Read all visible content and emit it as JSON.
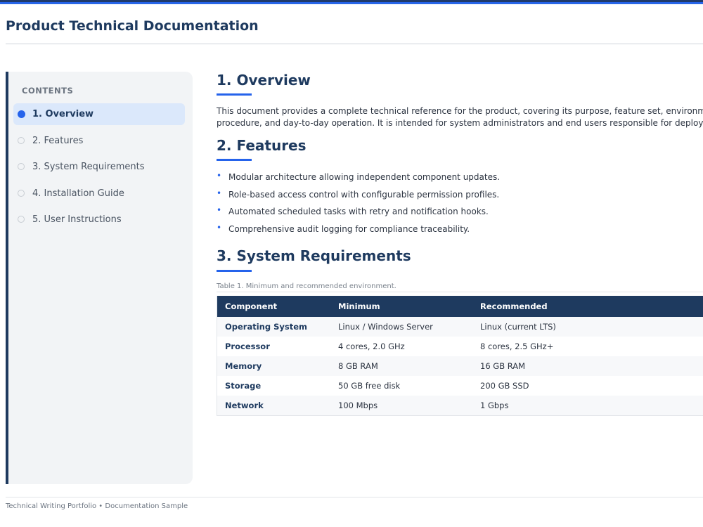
{
  "header": {
    "title": "Product Technical Documentation"
  },
  "sidebar": {
    "heading": "CONTENTS",
    "items": [
      {
        "label": "1. Overview",
        "active": true
      },
      {
        "label": "2. Features",
        "active": false
      },
      {
        "label": "3. System Requirements",
        "active": false
      },
      {
        "label": "4. Installation Guide",
        "active": false
      },
      {
        "label": "5. User Instructions",
        "active": false
      }
    ]
  },
  "main": {
    "overview": {
      "heading": "1. Overview",
      "lines": [
        "This document provides a complete technical reference for the product, covering its purpose, feature set, environment",
        "procedure, and day-to-day operation. It is intended for system administrators and end users responsible for deployment"
      ]
    },
    "features": {
      "heading": "2. Features",
      "bullet": "•",
      "items": [
        "Modular architecture allowing independent component updates.",
        "Role-based access control with configurable permission profiles.",
        "Automated scheduled tasks with retry and notification hooks.",
        "Comprehensive audit logging for compliance traceability."
      ]
    },
    "requirements": {
      "heading": "3. System Requirements",
      "caption": "Table 1. Minimum and recommended environment.",
      "columns": [
        "Component",
        "Minimum",
        "Recommended"
      ],
      "rows": [
        [
          "Operating System",
          "Linux / Windows Server",
          "Linux (current LTS)"
        ],
        [
          "Processor",
          "4 cores, 2.0 GHz",
          "8 cores, 2.5 GHz+"
        ],
        [
          "Memory",
          "8 GB RAM",
          "16 GB RAM"
        ],
        [
          "Storage",
          "50 GB free disk",
          "200 GB SSD"
        ],
        [
          "Network",
          "100 Mbps",
          "1 Gbps"
        ]
      ]
    }
  },
  "footer": {
    "text": "Technical Writing Portfolio  •  Documentation Sample"
  },
  "colors": {
    "primary": "#1e3a5f",
    "accent": "#2563eb",
    "sidebar_bg": "#f2f4f6",
    "active_item_bg": "#dbe8fb"
  }
}
